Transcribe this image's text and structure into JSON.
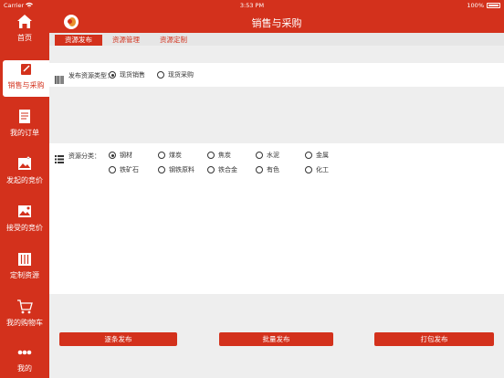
{
  "status_bar": {
    "carrier": "Carrier",
    "time": "3:53 PM",
    "battery": "100%"
  },
  "sidebar": {
    "items": [
      {
        "label": "首页",
        "icon": "home-icon"
      },
      {
        "label": "销售与采购",
        "icon": "edit-icon"
      },
      {
        "label": "我的订单",
        "icon": "document-icon"
      },
      {
        "label": "发起的竞价",
        "icon": "image-up-icon"
      },
      {
        "label": "接受的竞价",
        "icon": "image-down-icon"
      },
      {
        "label": "定制资源",
        "icon": "columns-icon"
      },
      {
        "label": "我的购物车",
        "icon": "cart-icon"
      },
      {
        "label": "我的",
        "icon": "more-icon"
      }
    ]
  },
  "header": {
    "title": "销售与采购"
  },
  "tabs": [
    {
      "label": "资源发布"
    },
    {
      "label": "资源管理"
    },
    {
      "label": "资源定制"
    }
  ],
  "publish_type": {
    "label": "发布资源类型：",
    "options": [
      {
        "label": "现货销售",
        "selected": true
      },
      {
        "label": "现货采购",
        "selected": false
      }
    ]
  },
  "category": {
    "label": "资源分类：",
    "options": [
      {
        "label": "钢材",
        "selected": true
      },
      {
        "label": "煤炭",
        "selected": false
      },
      {
        "label": "焦炭",
        "selected": false
      },
      {
        "label": "水泥",
        "selected": false
      },
      {
        "label": "金属",
        "selected": false
      },
      {
        "label": "铁矿石",
        "selected": false
      },
      {
        "label": "钢铁原料",
        "selected": false
      },
      {
        "label": "铁合金",
        "selected": false
      },
      {
        "label": "有色",
        "selected": false
      },
      {
        "label": "化工",
        "selected": false
      }
    ]
  },
  "buttons": {
    "single": "逐条发布",
    "batch": "批量发布",
    "package": "打包发布"
  },
  "colors": {
    "accent": "#d3311c",
    "panel": "#ffffff",
    "background": "#eeeeee"
  }
}
